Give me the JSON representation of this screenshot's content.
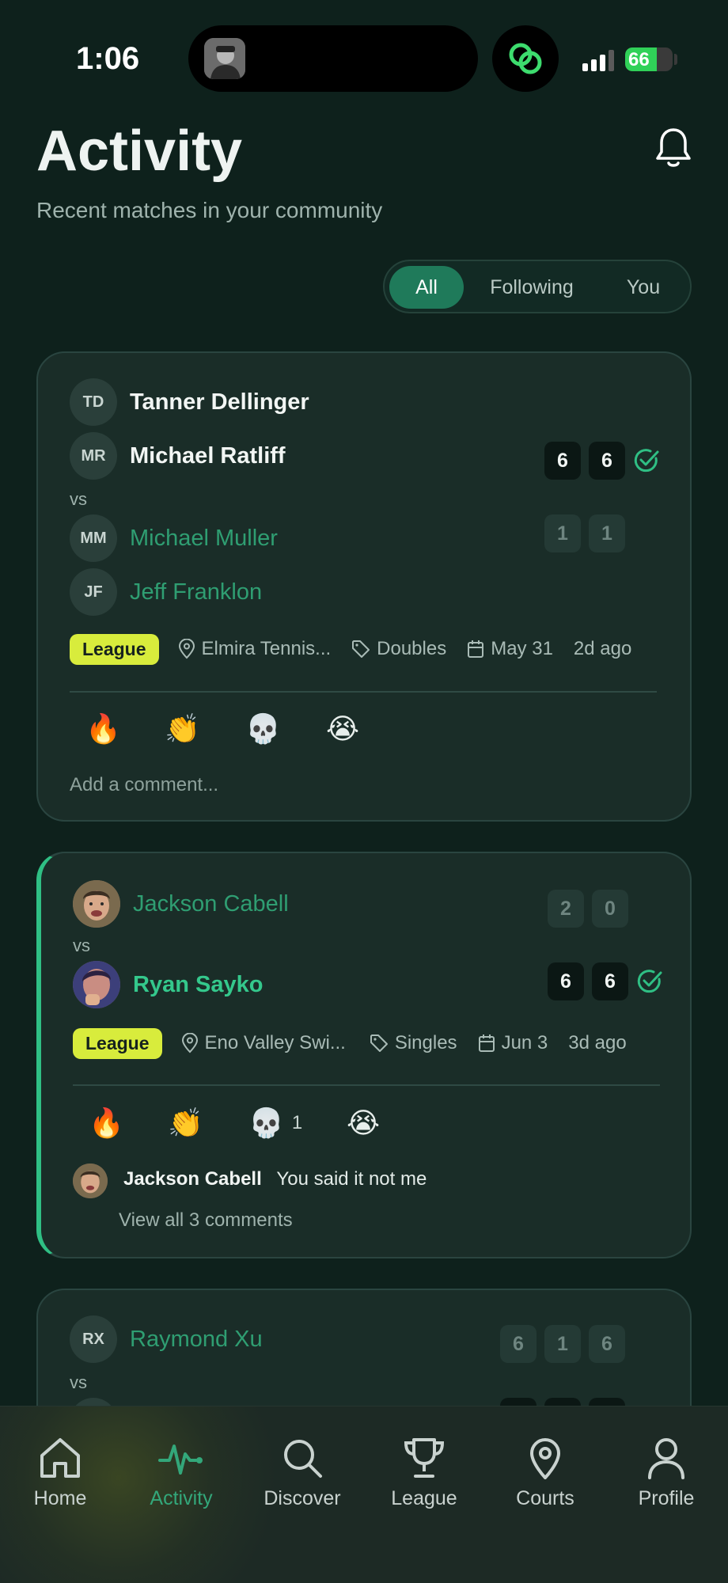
{
  "status_bar": {
    "time": "1:06",
    "battery": "66",
    "battery_level": 0.66
  },
  "header": {
    "title": "Activity",
    "subtitle": "Recent matches in your community",
    "bell_icon": "bell-icon"
  },
  "filter": {
    "options": [
      "All",
      "Following",
      "You"
    ],
    "selected": "All"
  },
  "matches": [
    {
      "team1": [
        {
          "initials": "TD",
          "name": "Tanner Dellinger"
        },
        {
          "initials": "MR",
          "name": "Michael Ratliff"
        }
      ],
      "team1_scores": [
        "6",
        "6"
      ],
      "vs": "vs",
      "team2": [
        {
          "initials": "MM",
          "name": "Michael Muller"
        },
        {
          "initials": "JF",
          "name": "Jeff Franklon"
        }
      ],
      "team2_scores": [
        "1",
        "1"
      ],
      "badge": "League",
      "location": "Elmira Tennis...",
      "format": "Doubles",
      "date": "May 31",
      "ago": "2d ago",
      "reactions": [
        "🔥",
        "👏",
        "💀",
        "😭"
      ],
      "add_comment": "Add a comment..."
    },
    {
      "team1": [
        {
          "name": "Jackson Cabell"
        }
      ],
      "team1_scores": [
        "2",
        "0"
      ],
      "vs": "vs",
      "team2": [
        {
          "name": "Ryan Sayko"
        }
      ],
      "team2_scores": [
        "6",
        "6"
      ],
      "badge": "League",
      "location": "Eno Valley Swi...",
      "format": "Singles",
      "date": "Jun 3",
      "ago": "3d ago",
      "reactions": [
        "🔥",
        "👏",
        "💀",
        "😭"
      ],
      "reaction_counts": {
        "skull": "1"
      },
      "comment": {
        "author": "Jackson Cabell",
        "text": "You said it not me"
      },
      "view_all": "View all 3 comments"
    },
    {
      "team1": [
        {
          "initials": "RX",
          "name": "Raymond Xu"
        }
      ],
      "team1_scores": [
        "6",
        "1",
        "6"
      ],
      "vs": "vs"
    }
  ],
  "tabbar": {
    "tabs": [
      {
        "label": "Home",
        "icon": "home-icon"
      },
      {
        "label": "Activity",
        "icon": "activity-icon"
      },
      {
        "label": "Discover",
        "icon": "search-icon"
      },
      {
        "label": "League",
        "icon": "trophy-icon"
      },
      {
        "label": "Courts",
        "icon": "map-pin-icon"
      },
      {
        "label": "Profile",
        "icon": "person-icon"
      }
    ],
    "active": "Activity"
  }
}
